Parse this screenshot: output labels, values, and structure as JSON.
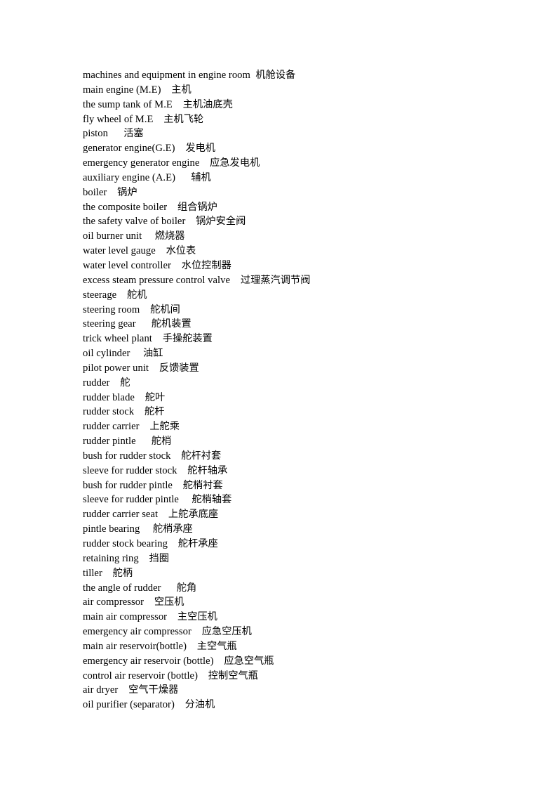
{
  "document": {
    "page_background": "#ffffff",
    "text_color": "#000000",
    "title": "machines and equipment in engine room",
    "entries": [
      {
        "english": "machines and equipment in engine room",
        "gap": "  ",
        "chinese": "机舱设备"
      },
      {
        "english": "main engine (M.E)",
        "gap": "    ",
        "chinese": "主机"
      },
      {
        "english": "the sump tank of M.E",
        "gap": "    ",
        "chinese": "主机油底壳"
      },
      {
        "english": "fly wheel of M.E",
        "gap": "    ",
        "chinese": "主机飞轮"
      },
      {
        "english": "piston",
        "gap": "      ",
        "chinese": "活塞"
      },
      {
        "english": "generator engine(G.E)",
        "gap": "    ",
        "chinese": "发电机"
      },
      {
        "english": "emergency generator engine",
        "gap": "    ",
        "chinese": "应急发电机"
      },
      {
        "english": "auxiliary engine (A.E)",
        "gap": "      ",
        "chinese": "辅机"
      },
      {
        "english": "boiler",
        "gap": "    ",
        "chinese": "锅炉"
      },
      {
        "english": "the composite boiler",
        "gap": "    ",
        "chinese": "组合锅炉"
      },
      {
        "english": "the safety valve of boiler",
        "gap": "    ",
        "chinese": "锅炉安全阀"
      },
      {
        "english": "oil burner unit",
        "gap": "     ",
        "chinese": "燃烧器"
      },
      {
        "english": "water level gauge",
        "gap": "    ",
        "chinese": "水位表"
      },
      {
        "english": "water level controller",
        "gap": "    ",
        "chinese": "水位控制器"
      },
      {
        "english": "excess steam pressure control valve",
        "gap": "    ",
        "chinese": "过理蒸汽调节阀"
      },
      {
        "english": "steerage",
        "gap": "    ",
        "chinese": "舵机"
      },
      {
        "english": "steering room",
        "gap": "    ",
        "chinese": "舵机间"
      },
      {
        "english": "steering gear",
        "gap": "      ",
        "chinese": "舵机装置"
      },
      {
        "english": "trick wheel plant",
        "gap": "    ",
        "chinese": "手操舵装置"
      },
      {
        "english": "oil cylinder",
        "gap": "     ",
        "chinese": "油缸"
      },
      {
        "english": "pilot power unit",
        "gap": "    ",
        "chinese": "反馈装置"
      },
      {
        "english": "rudder",
        "gap": "    ",
        "chinese": "舵"
      },
      {
        "english": "rudder blade",
        "gap": "    ",
        "chinese": "舵叶"
      },
      {
        "english": "rudder stock",
        "gap": "    ",
        "chinese": "舵杆"
      },
      {
        "english": "rudder carrier",
        "gap": "    ",
        "chinese": "上舵乘"
      },
      {
        "english": "rudder pintle",
        "gap": "      ",
        "chinese": "舵梢"
      },
      {
        "english": "bush for rudder stock",
        "gap": "    ",
        "chinese": "舵杆衬套"
      },
      {
        "english": "sleeve for rudder stock",
        "gap": "    ",
        "chinese": "舵杆轴承"
      },
      {
        "english": "bush for rudder pintle",
        "gap": "    ",
        "chinese": "舵梢衬套"
      },
      {
        "english": "sleeve for rudder pintle",
        "gap": "     ",
        "chinese": "舵梢轴套"
      },
      {
        "english": "rudder carrier seat",
        "gap": "    ",
        "chinese": "上舵承底座"
      },
      {
        "english": "pintle bearing",
        "gap": "     ",
        "chinese": "舵梢承座"
      },
      {
        "english": "rudder stock bearing",
        "gap": "    ",
        "chinese": "舵杆承座"
      },
      {
        "english": "retaining ring",
        "gap": "    ",
        "chinese": "挡圈"
      },
      {
        "english": "tiller",
        "gap": "    ",
        "chinese": "舵柄"
      },
      {
        "english": "the angle of rudder",
        "gap": "      ",
        "chinese": "舵角"
      },
      {
        "english": "air compressor",
        "gap": "    ",
        "chinese": "空压机"
      },
      {
        "english": "main air compressor",
        "gap": "    ",
        "chinese": "主空压机"
      },
      {
        "english": "emergency air compressor",
        "gap": "    ",
        "chinese": "应急空压机"
      },
      {
        "english": "main air reservoir(bottle)",
        "gap": "    ",
        "chinese": "主空气瓶"
      },
      {
        "english": "emergency air reservoir (bottle)",
        "gap": "    ",
        "chinese": "应急空气瓶"
      },
      {
        "english": "control air reservoir (bottle)",
        "gap": "    ",
        "chinese": "控制空气瓶"
      },
      {
        "english": "air dryer",
        "gap": "    ",
        "chinese": "空气干燥器"
      },
      {
        "english": "oil purifier (separator)",
        "gap": "    ",
        "chinese": "分油机"
      }
    ]
  }
}
